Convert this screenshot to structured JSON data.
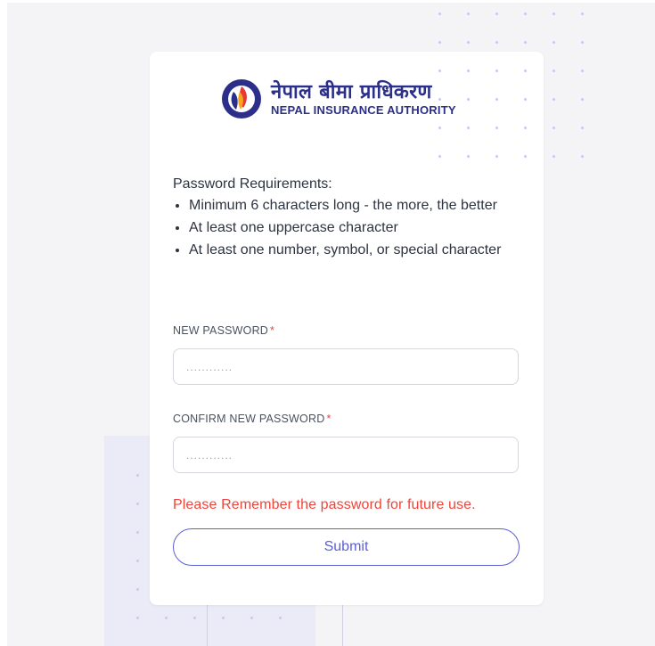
{
  "logo": {
    "nepali_text": "नेपाल बीमा प्राधिकरण",
    "english_text": "NEPAL INSURANCE AUTHORITY",
    "icon": "nia-emblem-icon"
  },
  "requirements": {
    "title": "Password Requirements:",
    "items": [
      "Minimum 6 characters long - the more, the better",
      "At least one uppercase character",
      "At least one number, symbol, or special character"
    ]
  },
  "new_password": {
    "label": "NEW PASSWORD",
    "required_mark": "*",
    "placeholder": "............"
  },
  "confirm_password": {
    "label": "CONFIRM NEW PASSWORD",
    "required_mark": "*",
    "placeholder": "............"
  },
  "warning": "Please Remember the password for future use.",
  "submit_label": "Submit",
  "colors": {
    "brand": "#2b2f8a",
    "accent": "#5b5fd6",
    "warning": "#f0443a",
    "background": "#f4f4f7"
  }
}
